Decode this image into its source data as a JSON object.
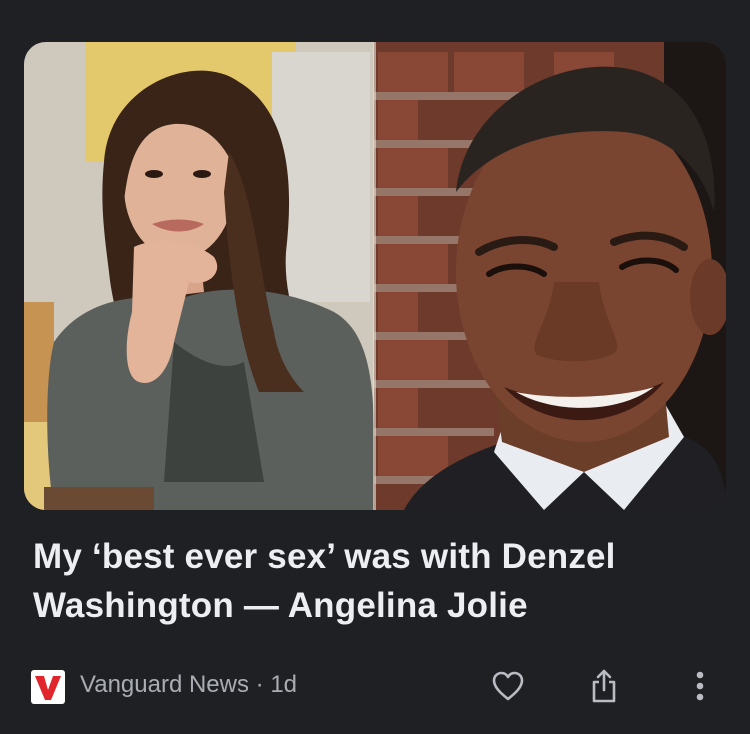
{
  "article": {
    "headline": "My ‘best ever sex’ was with Denzel Washington — Angelina Jolie",
    "image": {
      "left_description": "woman with long dark hair, grey sweater, chin resting on hand",
      "right_description": "smiling man in suit against brick wall"
    }
  },
  "source": {
    "name": "Vanguard News",
    "separator": "·",
    "age": "1d",
    "logo_letter": "V",
    "logo_color": "#e0262b"
  },
  "actions": {
    "like_icon": "heart-icon",
    "share_icon": "share-icon",
    "more_icon": "more-vertical-icon"
  },
  "colors": {
    "background": "#1f2023",
    "headline": "#eceef2",
    "meta": "#a9acb3",
    "icon": "#b9bcc2"
  }
}
